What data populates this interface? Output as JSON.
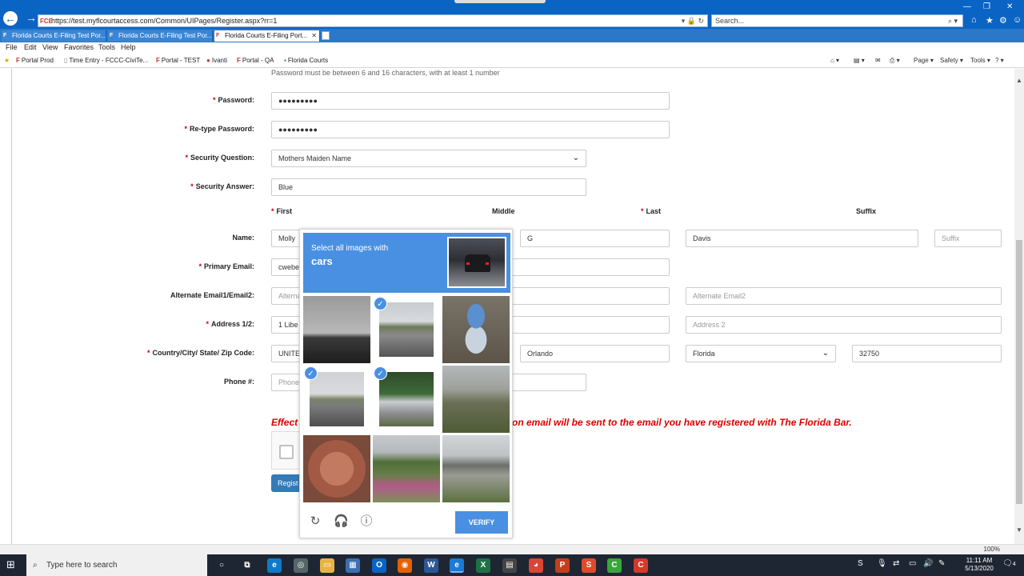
{
  "browser": {
    "url": "https://test.myflcourtaccess.com/Common/UIPages/Register.aspx?rr=1",
    "url_favicon": "FCE",
    "search_placeholder": "Search...",
    "tabs": [
      {
        "label": "Florida Courts E-Filing Test Por..."
      },
      {
        "label": "Florida Courts E-Filing Test Por..."
      },
      {
        "label": "Florida Courts E-Filing Port..."
      }
    ],
    "menu": [
      "File",
      "Edit",
      "View",
      "Favorites",
      "Tools",
      "Help"
    ],
    "favorites": [
      "Portal Prod",
      "Time Entry - FCCC-CiviTe...",
      "Portal - TEST",
      "Ivanti",
      "Portal - QA",
      "Florida Courts"
    ],
    "commands": [
      "Page ▾",
      "Safety ▾",
      "Tools ▾"
    ],
    "zoom": "100%"
  },
  "form": {
    "password_hint": "Password must be between 6 and 16 characters, with at least 1 number",
    "password_label": "Password:",
    "password_value": "●●●●●●●●●",
    "retype_label": "Re-type Password:",
    "retype_value": "●●●●●●●●●",
    "security_question_label": "Security Question:",
    "security_question_value": "Mothers Maiden Name",
    "security_answer_label": "Security Answer:",
    "security_answer_value": "Blue",
    "col_first": "First",
    "col_middle": "Middle",
    "col_last": "Last",
    "col_suffix": "Suffix",
    "name_label": "Name:",
    "first_value": "Molly",
    "middle_value": "G",
    "last_value": "Davis",
    "suffix_placeholder": "Suffix",
    "primary_email_label": "Primary Email:",
    "primary_email_value": "cwebe",
    "alt_email_label": "Alternate Email1/Email2:",
    "alt_email1_placeholder": "Alterna",
    "alt_email2_placeholder": "Alternate Email2",
    "address_label": "Address 1/2:",
    "address1_value": "1 Libe",
    "address2_placeholder": "Address 2",
    "country_label": "Country/City/ State/ Zip Code:",
    "country_value": "UNITE",
    "city_value": "Orlando",
    "state_value": "Florida",
    "zip_value": "32750",
    "phone_label": "Phone #:",
    "phone_placeholder": "Phone",
    "notice_left": "Effect",
    "notice_right": "on email will be sent to the email you have registered with The Florida Bar.",
    "register_label": "Regist"
  },
  "captcha": {
    "prompt": "Select all images with",
    "target": "cars",
    "verify_label": "VERIFY",
    "tiles": [
      {
        "selected": false
      },
      {
        "selected": true
      },
      {
        "selected": false
      },
      {
        "selected": true
      },
      {
        "selected": true
      },
      {
        "selected": false
      },
      {
        "selected": false
      },
      {
        "selected": false
      },
      {
        "selected": false
      }
    ]
  },
  "taskbar": {
    "search_placeholder": "Type here to search",
    "time": "11:11 AM",
    "date": "5/13/2020",
    "notification_count": "4"
  },
  "colors": {
    "ie_blue": "#0a64c4",
    "captcha_blue": "#4a90e2",
    "required_red": "#cc0000",
    "register_button": "#337ab7"
  }
}
